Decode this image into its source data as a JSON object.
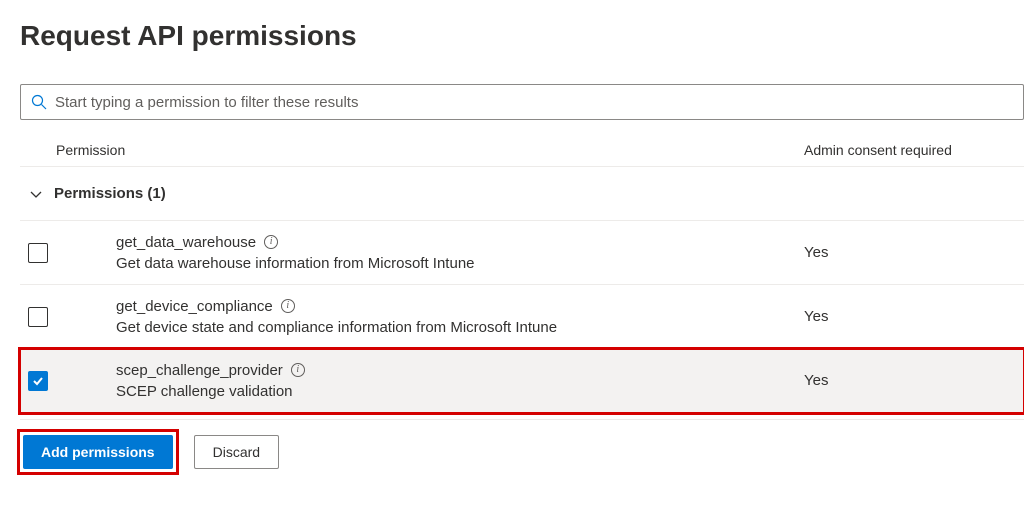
{
  "title": "Request API permissions",
  "search": {
    "placeholder": "Start typing a permission to filter these results"
  },
  "headers": {
    "permission": "Permission",
    "consent": "Admin consent required"
  },
  "group": {
    "label": "Permissions (1)"
  },
  "permissions": [
    {
      "name": "get_data_warehouse",
      "description": "Get data warehouse information from Microsoft Intune",
      "consent": "Yes",
      "checked": false
    },
    {
      "name": "get_device_compliance",
      "description": "Get device state and compliance information from Microsoft Intune",
      "consent": "Yes",
      "checked": false
    },
    {
      "name": "scep_challenge_provider",
      "description": "SCEP challenge validation",
      "consent": "Yes",
      "checked": true
    }
  ],
  "buttons": {
    "add": "Add permissions",
    "discard": "Discard"
  }
}
